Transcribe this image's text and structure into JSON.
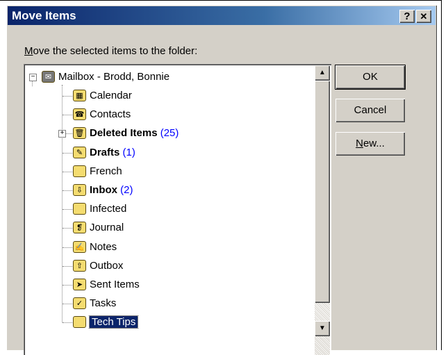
{
  "window": {
    "title": "Move Items",
    "help_button": "?",
    "close_button": "✕"
  },
  "dialog": {
    "instruction": "Move the selected items to the folder:",
    "instruction_accel": "M",
    "instruction_rest": "ove the selected items to the folder:"
  },
  "tree": {
    "root": {
      "label": "Mailbox - Brodd, Bonnie",
      "icon": "mailbox-icon",
      "expander": "−"
    },
    "folders": [
      {
        "label": "Calendar",
        "icon": "calendar-icon",
        "bold": false,
        "count": ""
      },
      {
        "label": "Contacts",
        "icon": "contacts-icon",
        "bold": false,
        "count": ""
      },
      {
        "label": "Deleted Items",
        "icon": "deleted-items-icon",
        "bold": true,
        "count": "(25)",
        "expander": "+"
      },
      {
        "label": "Drafts",
        "icon": "drafts-icon",
        "bold": true,
        "count": "(1)"
      },
      {
        "label": "French",
        "icon": "folder-icon",
        "bold": false,
        "count": ""
      },
      {
        "label": "Inbox",
        "icon": "inbox-icon",
        "bold": true,
        "count": "(2)"
      },
      {
        "label": "Infected",
        "icon": "folder-icon",
        "bold": false,
        "count": ""
      },
      {
        "label": "Journal",
        "icon": "journal-icon",
        "bold": false,
        "count": ""
      },
      {
        "label": "Notes",
        "icon": "notes-icon",
        "bold": false,
        "count": ""
      },
      {
        "label": "Outbox",
        "icon": "outbox-icon",
        "bold": false,
        "count": ""
      },
      {
        "label": "Sent Items",
        "icon": "sent-items-icon",
        "bold": false,
        "count": ""
      },
      {
        "label": "Tasks",
        "icon": "tasks-icon",
        "bold": false,
        "count": ""
      },
      {
        "label": "Tech Tips",
        "icon": "folder-icon",
        "bold": false,
        "count": "",
        "selected": true
      }
    ],
    "scroll_up": "▲",
    "scroll_down": "▼"
  },
  "buttons": {
    "ok": "OK",
    "cancel": "Cancel",
    "new_accel": "N",
    "new_rest": "ew..."
  }
}
